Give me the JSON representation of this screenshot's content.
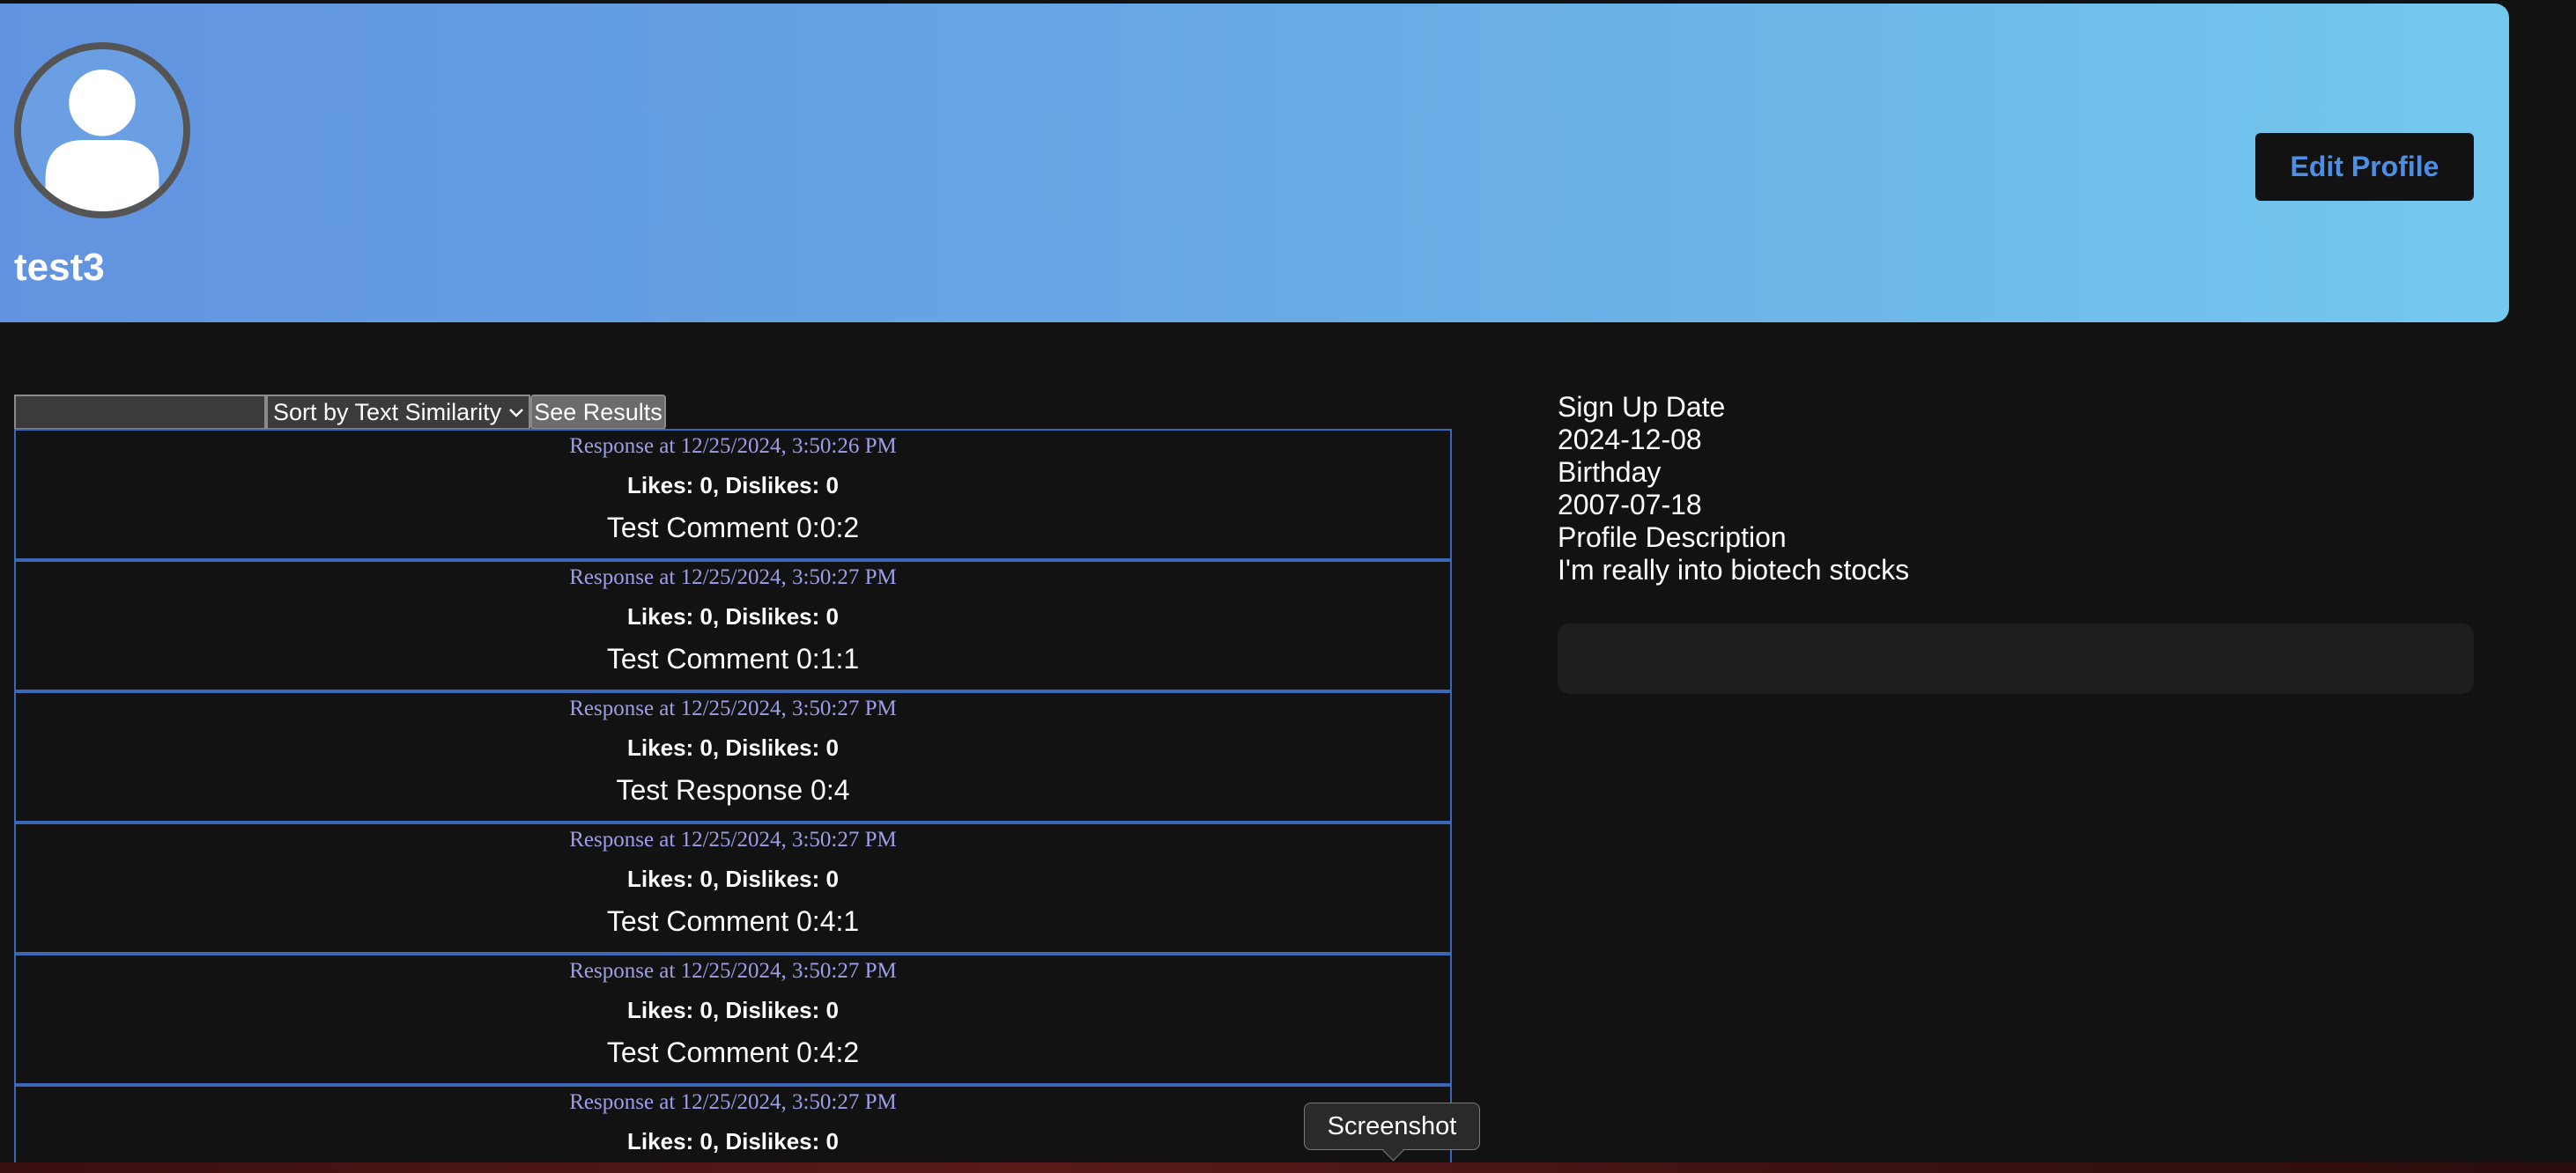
{
  "profile": {
    "username": "test3",
    "edit_label": "Edit Profile"
  },
  "search": {
    "query": "",
    "sort_selected": "Sort by Text Similarity",
    "submit_label": "See Results"
  },
  "responses": [
    {
      "time": "Response at 12/25/2024, 3:50:26 PM",
      "likes": "Likes: 0, Dislikes: 0",
      "text": "Test Comment 0:0:2"
    },
    {
      "time": "Response at 12/25/2024, 3:50:27 PM",
      "likes": "Likes: 0, Dislikes: 0",
      "text": "Test Comment 0:1:1"
    },
    {
      "time": "Response at 12/25/2024, 3:50:27 PM",
      "likes": "Likes: 0, Dislikes: 0",
      "text": "Test Response 0:4"
    },
    {
      "time": "Response at 12/25/2024, 3:50:27 PM",
      "likes": "Likes: 0, Dislikes: 0",
      "text": "Test Comment 0:4:1"
    },
    {
      "time": "Response at 12/25/2024, 3:50:27 PM",
      "likes": "Likes: 0, Dislikes: 0",
      "text": "Test Comment 0:4:2"
    },
    {
      "time": "Response at 12/25/2024, 3:50:27 PM",
      "likes": "Likes: 0, Dislikes: 0",
      "text": ""
    }
  ],
  "info": {
    "signup_label": "Sign Up Date",
    "signup_value": "2024-12-08",
    "birthday_label": "Birthday",
    "birthday_value": "2007-07-18",
    "description_label": "Profile Description",
    "description_value": "I'm really into biotech stocks"
  },
  "tooltip": {
    "label": "Screenshot"
  },
  "colors": {
    "background": "#121212",
    "banner_start": "#6293e0",
    "banner_end": "#74c8ee",
    "card_border": "#3b67b8",
    "timestamp": "#9e9ee8",
    "edit_text": "#4d8fe6"
  },
  "icons": {
    "avatar": "user-silhouette-icon",
    "sort_chevron": "chevron-down-icon"
  }
}
